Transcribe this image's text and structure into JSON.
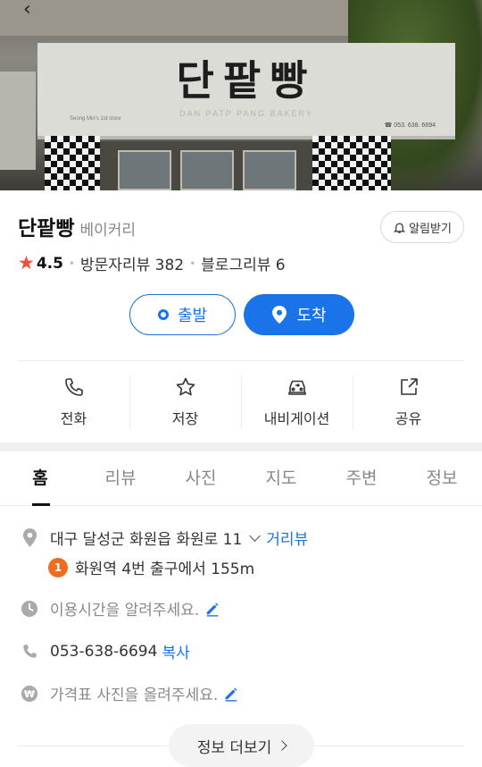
{
  "hero": {
    "sign_title": "단팥빵",
    "sign_subtitle": "DAN PATP PANG BAKERY",
    "sign_small_text": "Seong Min's 1st store",
    "sign_phone": "☎ 053. 638. 6694"
  },
  "place": {
    "name": "단팥빵",
    "category": "베이커리",
    "notify_label": "알림받기",
    "rating": "4.5",
    "visitor_reviews": "방문자리뷰 382",
    "blog_reviews": "블로그리뷰 6"
  },
  "route": {
    "depart_label": "출발",
    "arrive_label": "도착"
  },
  "actions": [
    {
      "label": "전화",
      "icon": "phone-icon"
    },
    {
      "label": "저장",
      "icon": "star-icon"
    },
    {
      "label": "내비게이션",
      "icon": "car-icon"
    },
    {
      "label": "공유",
      "icon": "share-icon"
    }
  ],
  "tabs": [
    {
      "label": "홈",
      "active": true
    },
    {
      "label": "리뷰"
    },
    {
      "label": "사진"
    },
    {
      "label": "지도"
    },
    {
      "label": "주변"
    },
    {
      "label": "정보"
    }
  ],
  "info": {
    "address": "대구 달성군 화원읍 화원로 11",
    "street_view": "거리뷰",
    "station_line": "1",
    "station_directions": "화원역 4번 출구에서 155m",
    "hours_prompt": "이용시간을 알려주세요.",
    "phone": "053-638-6694",
    "copy_label": "복사",
    "price_prompt": "가격표 사진을 올려주세요."
  },
  "more_label": "정보 더보기",
  "colors": {
    "accent": "#1a73e8",
    "star": "#f44b3b",
    "station_line_1": "#f26b21"
  }
}
